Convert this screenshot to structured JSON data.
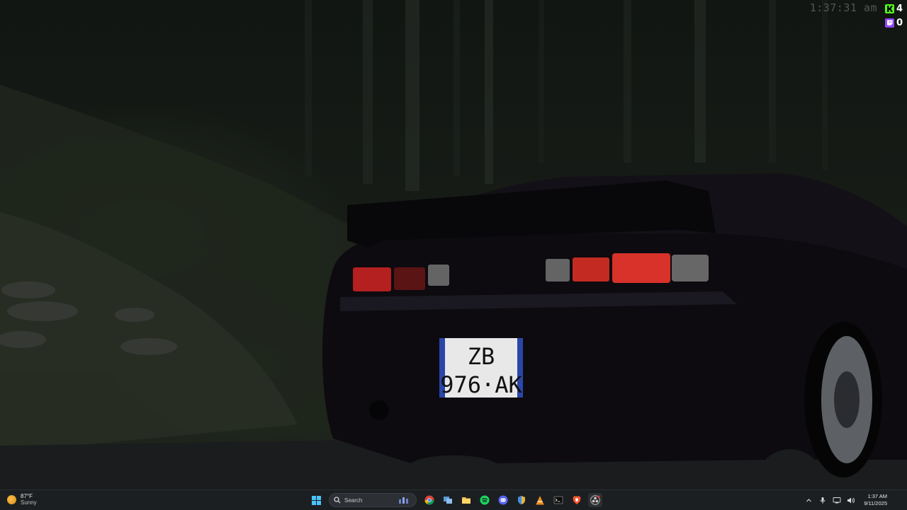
{
  "overlay": {
    "clock": "1:37:31 am",
    "kick_icon": "kick-icon",
    "kick_count": "4",
    "twitch_icon": "twitch-icon",
    "twitch_count": "0"
  },
  "wallpaper": {
    "plate_line1": "ZB",
    "plate_line2": "976·AK"
  },
  "taskbar": {
    "weather": {
      "icon": "sun-icon",
      "temp": "87°F",
      "condition": "Sunny"
    },
    "start_icon": "windows-start-icon",
    "search": {
      "icon": "search-icon",
      "placeholder": "Search"
    },
    "apps": [
      {
        "name": "chrome-icon"
      },
      {
        "name": "task-view-icon"
      },
      {
        "name": "file-explorer-icon"
      },
      {
        "name": "spotify-icon"
      },
      {
        "name": "discord-icon"
      },
      {
        "name": "shield-app-icon"
      },
      {
        "name": "vlc-icon"
      },
      {
        "name": "terminal-icon"
      },
      {
        "name": "brave-icon"
      },
      {
        "name": "obs-icon"
      }
    ],
    "tray": {
      "chevron": "chevron-up-icon",
      "mic": "microphone-icon",
      "network": "network-icon",
      "volume": "volume-icon",
      "time": "1:37 AM",
      "date": "9/11/2025"
    },
    "colors": {
      "bg": "#1c1f22",
      "accent": "#4cc2ff"
    }
  }
}
